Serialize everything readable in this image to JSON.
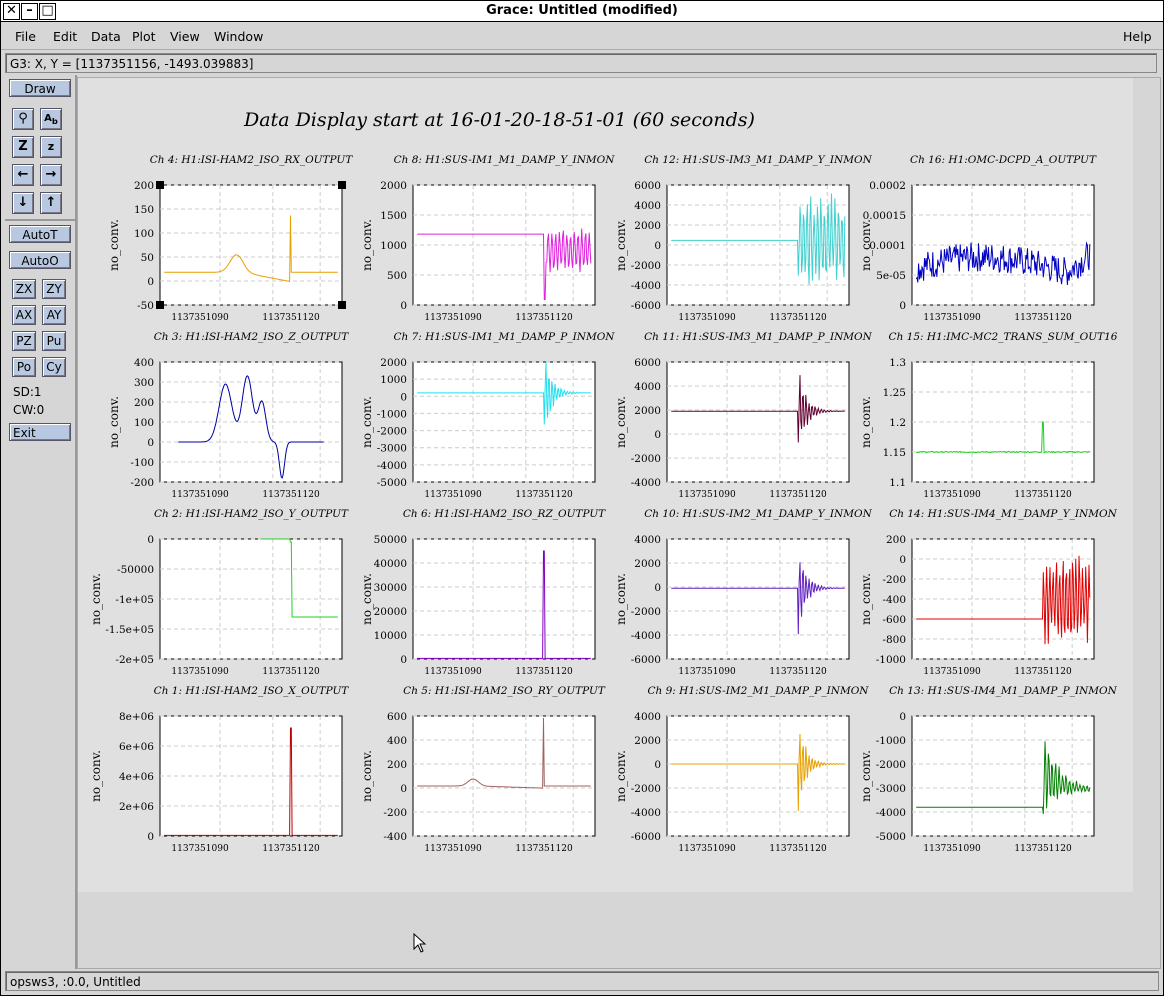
{
  "window": {
    "title": "Grace: Untitled (modified)"
  },
  "menubar": {
    "items": [
      "File",
      "Edit",
      "Data",
      "Plot",
      "View",
      "Window"
    ],
    "help": "Help"
  },
  "locator": "G3: X, Y = [1137351156, -1493.039883]",
  "toolbar": {
    "draw": "Draw",
    "autot": "AutoT",
    "autoo": "AutoO",
    "zx": "ZX",
    "zy": "ZY",
    "ax": "AX",
    "ay": "AY",
    "pz": "PZ",
    "pu": "Pu",
    "po": "Po",
    "cy": "Cy",
    "sd": "SD:1",
    "cw": "CW:0",
    "exit": "Exit"
  },
  "status": "opsws3, :0.0, Untitled",
  "chart_data": {
    "type": "line",
    "title": "Data Display start at 16-01-20-18-51-01 (60 seconds)",
    "ylabel": "no_conv.",
    "x_ticks": [
      "1137351090",
      "1137351120"
    ],
    "panels": [
      {
        "title": "Ch 4: H1:ISI-HAM2_ISO_RX_OUTPUT",
        "color": "#e8a000",
        "yticks": [
          "200",
          "150",
          "100",
          "50",
          "0",
          "-50"
        ],
        "ylim": [
          -75,
          200
        ],
        "pattern": "bump-spike"
      },
      {
        "title": "Ch 8: H1:SUS-IM1_M1_DAMP_Y_INMON",
        "color": "#e020e0",
        "yticks": [
          "2000",
          "1500",
          "1000",
          "500",
          "0"
        ],
        "ylim": [
          -200,
          2000
        ],
        "pattern": "flat-osc",
        "flat": 1100
      },
      {
        "title": "Ch 12: H1:SUS-IM3_M1_DAMP_Y_INMON",
        "color": "#40d0d0",
        "yticks": [
          "6000",
          "4000",
          "2000",
          "0",
          "-2000",
          "-4000",
          "-6000"
        ],
        "ylim": [
          -7000,
          6000
        ],
        "pattern": "flat-big-osc",
        "flat": 0
      },
      {
        "title": "Ch 16: H1:OMC-DCPD_A_OUTPUT",
        "color": "#0000c0",
        "yticks": [
          "0.0002",
          "0.00015",
          "0.0001",
          "5e-05",
          "0"
        ],
        "ylim": [
          0,
          0.0002
        ],
        "pattern": "noise"
      },
      {
        "title": "Ch 3: H1:ISI-HAM2_ISO_Z_OUTPUT",
        "color": "#0000a0",
        "yticks": [
          "400",
          "300",
          "200",
          "100",
          "0",
          "-100",
          "-200"
        ],
        "ylim": [
          -200,
          400
        ],
        "pattern": "double-hump"
      },
      {
        "title": "Ch 7: H1:SUS-IM1_M1_DAMP_P_INMON",
        "color": "#20e0f0",
        "yticks": [
          "2000",
          "1000",
          "0",
          "-1000",
          "-2000",
          "-3000",
          "-4000",
          "-5000"
        ],
        "ylim": [
          -5000,
          2000
        ],
        "pattern": "flat-decay",
        "flat": 200
      },
      {
        "title": "Ch 11: H1:SUS-IM3_M1_DAMP_P_INMON",
        "color": "#600030",
        "yticks": [
          "6000",
          "4000",
          "2000",
          "0",
          "-2000",
          "-4000"
        ],
        "ylim": [
          -4000,
          6000
        ],
        "pattern": "flat-decay",
        "flat": 1900
      },
      {
        "title": "Ch 15: H1:IMC-MC2_TRANS_SUM_OUT16",
        "color": "#20d020",
        "yticks": [
          "1.3",
          "1.25",
          "1.2",
          "1.15",
          "1.1"
        ],
        "ylim": [
          1.1,
          1.3
        ],
        "pattern": "flat-blip",
        "flat": 1.15
      },
      {
        "title": "Ch 2: H1:ISI-HAM2_ISO_Y_OUTPUT",
        "color": "#20d020",
        "yticks": [
          "0",
          "-50000",
          "-1e+05",
          "-1.5e+05",
          "-2e+05"
        ],
        "ylim": [
          -200000,
          0
        ],
        "pattern": "drop"
      },
      {
        "title": "Ch 6: H1:ISI-HAM2_ISO_RZ_OUTPUT",
        "color": "#8000c0",
        "yticks": [
          "50000",
          "40000",
          "30000",
          "20000",
          "10000",
          "0"
        ],
        "ylim": [
          0,
          50000
        ],
        "pattern": "spike-up"
      },
      {
        "title": "Ch 10: H1:SUS-IM2_M1_DAMP_Y_INMON",
        "color": "#6020c0",
        "yticks": [
          "4000",
          "2000",
          "0",
          "-2000",
          "-4000",
          "-6000"
        ],
        "ylim": [
          -6000,
          4000
        ],
        "pattern": "flat-decay",
        "flat": -100
      },
      {
        "title": "Ch 14: H1:SUS-IM4_M1_DAMP_Y_INMON",
        "color": "#e00000",
        "yticks": [
          "200",
          "0",
          "-200",
          "-400",
          "-600",
          "-800",
          "-1000"
        ],
        "ylim": [
          -1000,
          200
        ],
        "pattern": "flat-big-osc",
        "flat": -600
      },
      {
        "title": "Ch 1: H1:ISI-HAM2_ISO_X_OUTPUT",
        "color": "#c00000",
        "yticks": [
          "8e+06",
          "6e+06",
          "4e+06",
          "2e+06",
          "0"
        ],
        "ylim": [
          0,
          9000000
        ],
        "pattern": "spike-up"
      },
      {
        "title": "Ch 5: H1:ISI-HAM2_ISO_RY_OUTPUT",
        "color": "#a06060",
        "yticks": [
          "600",
          "400",
          "200",
          "0",
          "-200",
          "-400"
        ],
        "ylim": [
          -500,
          700
        ],
        "pattern": "bump-spike2"
      },
      {
        "title": "Ch 9: H1:SUS-IM2_M1_DAMP_P_INMON",
        "color": "#e8a000",
        "yticks": [
          "4000",
          "2000",
          "0",
          "-2000",
          "-4000",
          "-6000"
        ],
        "ylim": [
          -6000,
          5000
        ],
        "pattern": "flat-decay",
        "flat": 600
      },
      {
        "title": "Ch 13: H1:SUS-IM4_M1_DAMP_P_INMON",
        "color": "#008000",
        "yticks": [
          "0",
          "-1000",
          "-2000",
          "-3000",
          "-4000",
          "-5000"
        ],
        "ylim": [
          -5000,
          0
        ],
        "pattern": "flat-decay-neg",
        "flat": -3800
      }
    ]
  }
}
